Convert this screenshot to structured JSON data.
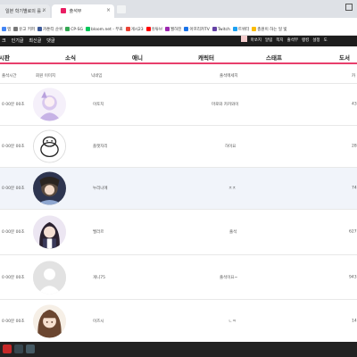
{
  "browser": {
    "tabs": [
      {
        "label": "일본 학기별로의 를 -"
      },
      {
        "label": "출석부"
      }
    ],
    "tab_close_glyph": "×",
    "bookmarks": [
      {
        "label": "앱",
        "color": "#4285f4"
      },
      {
        "label": "유고 키퍼",
        "color": "#777777"
      },
      {
        "label": "카툰티 순위",
        "color": "#3b5998"
      },
      {
        "label": "CP-SG",
        "color": "#34a853"
      },
      {
        "label": "bloom.net - 무료",
        "color": "#03c75a"
      },
      {
        "label": "게시23",
        "color": "#ea4335"
      },
      {
        "label": "유튜브",
        "color": "#ff0000"
      },
      {
        "label": "월하진",
        "color": "#9c27b0"
      },
      {
        "label": "아프리카TV",
        "color": "#1a73e8"
      },
      {
        "label": "Twitch",
        "color": "#6441a5"
      },
      {
        "label": "트위터",
        "color": "#1da1f2"
      },
      {
        "label": "총원이 하는 일 빛",
        "color": "#fbbc04"
      }
    ]
  },
  "site_nav": {
    "left": [
      "크",
      "인기글",
      "최신글",
      "댓글"
    ],
    "right": [
      "마쏘지",
      "알림",
      "쪽지",
      "출석부",
      "랭킹",
      "설정",
      "도"
    ]
  },
  "categories": [
    "시판",
    "소식",
    "애니",
    "캐릭터",
    "스태프",
    "도서"
  ],
  "table": {
    "headers": [
      "출석시간",
      "회원 이미지",
      "닉네임",
      "출석메세지",
      "카"
    ],
    "rows": [
      {
        "time": "0 00분 00초",
        "nick": "이토치",
        "message": "마로와 카카와이",
        "count": "43"
      },
      {
        "time": "0 00분 00초",
        "nick": "플랫자리",
        "message": "하이요",
        "count": "28"
      },
      {
        "time": "0 00분 00초",
        "nick": "누리니에",
        "message": "ㅊㅊ",
        "count": "74"
      },
      {
        "time": "0 00분 00초",
        "nick": "밸라르",
        "message": "출석",
        "count": "627"
      },
      {
        "time": "0 00분 00초",
        "nick": "게니75",
        "message": "출석이요~",
        "count": "943"
      },
      {
        "time": "0 00분 00초",
        "nick": "이즈시",
        "message": "ㄴㅋ",
        "count": "14"
      }
    ]
  },
  "colors": {
    "accent": "#e83e6c",
    "nav_bg": "#1d1d1d",
    "highlight_row": "#f1f4fa"
  }
}
